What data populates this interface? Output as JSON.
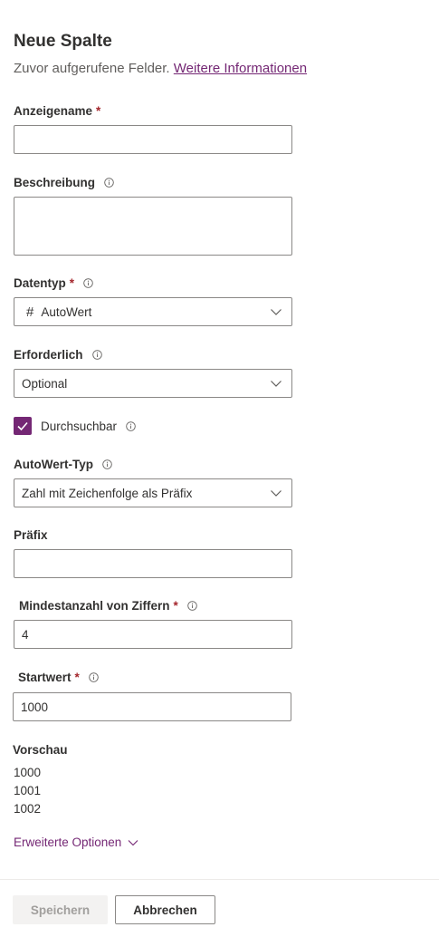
{
  "panel": {
    "title": "Neue Spalte",
    "subtitle": "Zuvor aufgerufene Felder.",
    "more_info_link": "Weitere Informationen"
  },
  "fields": {
    "display_name": {
      "label": "Anzeigename",
      "required_mark": "*",
      "value": ""
    },
    "description": {
      "label": "Beschreibung",
      "value": ""
    },
    "data_type": {
      "label": "Datentyp",
      "required_mark": "*",
      "icon": "#",
      "value": "AutoWert"
    },
    "required": {
      "label": "Erforderlich",
      "value": "Optional"
    },
    "searchable": {
      "label": "Durchsuchbar",
      "checked": true
    },
    "autonumber_type": {
      "label": "AutoWert-Typ",
      "value": "Zahl mit Zeichenfolge als Präfix"
    },
    "prefix": {
      "label": "Präfix",
      "value": ""
    },
    "min_digits": {
      "label": "Mindestanzahl von Ziffern",
      "required_mark": "*",
      "value": "4"
    },
    "seed": {
      "label": "Startwert",
      "required_mark": "*",
      "value": "1000"
    }
  },
  "preview": {
    "label": "Vorschau",
    "lines": [
      "1000",
      "1001",
      "1002"
    ]
  },
  "advanced_options": {
    "label": "Erweiterte Optionen"
  },
  "footer": {
    "save_label": "Speichern",
    "cancel_label": "Abbrechen"
  },
  "colors": {
    "accent": "#742774",
    "required": "#a4262c",
    "border": "#8a8886",
    "text": "#323130",
    "disabled_bg": "#f3f2f1",
    "disabled_text": "#a19f9d"
  }
}
